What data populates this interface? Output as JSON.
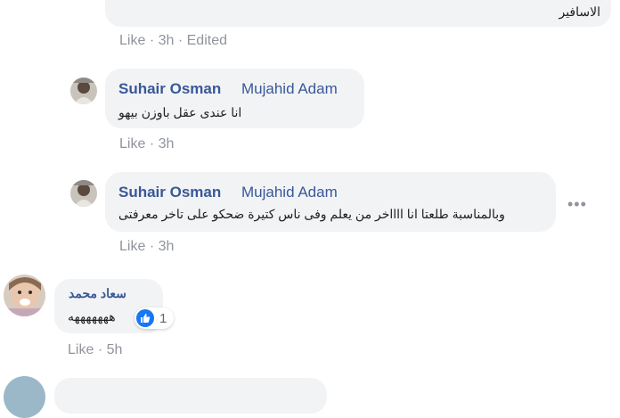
{
  "comments": [
    {
      "text": "الاسافير",
      "like_label": "Like",
      "time": "3h",
      "edited_label": "Edited",
      "separator": "·"
    },
    {
      "author": "Suhair Osman",
      "mention": "Mujahid Adam",
      "text": "انا عندى عقل باوزن بيهو",
      "like_label": "Like",
      "time": "3h",
      "separator": "·"
    },
    {
      "author": "Suhair Osman",
      "mention": "Mujahid Adam",
      "text": "وبالمناسبة طلعتا انا ااااخر من يعلم وفى ناس كتيرة ضحكو على تاخر معرفتى",
      "like_label": "Like",
      "time": "3h",
      "separator": "·",
      "more_icon": "more-options-icon"
    },
    {
      "author": "سعاد محمد",
      "text": "هههههههه",
      "like_label": "Like",
      "time": "5h",
      "separator": "·",
      "reaction_count": "1",
      "reaction_icon": "thumbs-up-icon"
    }
  ],
  "colors": {
    "bubble": "#f2f3f5",
    "name": "#385898",
    "meta": "#90949c",
    "like_badge": "#1877f2"
  }
}
